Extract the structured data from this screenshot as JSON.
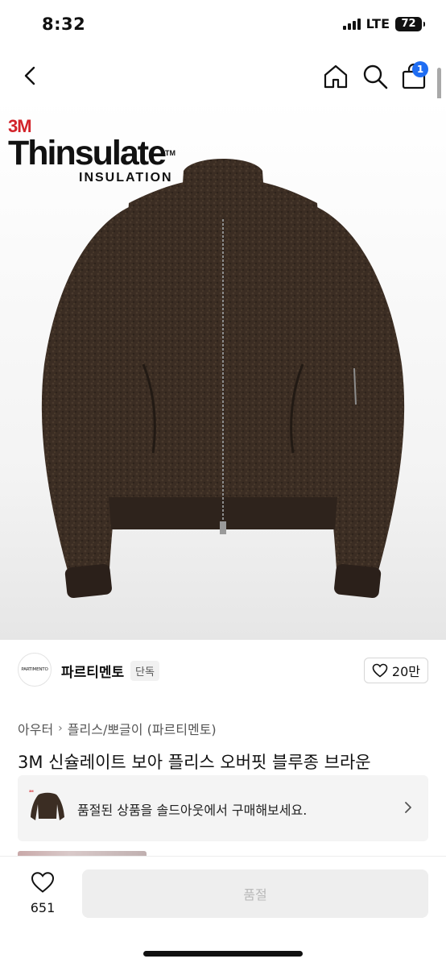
{
  "status_bar": {
    "time": "8:32",
    "network": "LTE",
    "battery": "72"
  },
  "nav": {
    "cart_badge": "1",
    "icons": [
      "chevron-left-icon",
      "home-icon",
      "search-icon",
      "shopping-bag-icon"
    ]
  },
  "hero": {
    "brand_logo": {
      "top": "3M",
      "name": "Thinsulate",
      "tm": "TM",
      "sub": "INSULATION"
    },
    "jacket_color": "#3b2d23"
  },
  "seller": {
    "avatar_text": "PARTIMENTO",
    "name": "파르티멘토",
    "tag": "단독",
    "likes": "20만"
  },
  "breadcrumb": {
    "category": "아우터",
    "subcategory": "플리스/뽀글이 (파르티멘토)"
  },
  "product": {
    "title": "3M 신슐레이트 보아 플리스 오버핏 블루종 브라운"
  },
  "soldout_banner": {
    "text": "품절된 상품을 솔드아웃에서 구매해보세요."
  },
  "bottom_bar": {
    "wish_count": "651",
    "button_label": "품절"
  },
  "colors": {
    "accent": "#1f6df2",
    "brand_red": "#d2232a",
    "disabled_bg": "#eeeeee",
    "disabled_text": "#b9b9b9"
  }
}
